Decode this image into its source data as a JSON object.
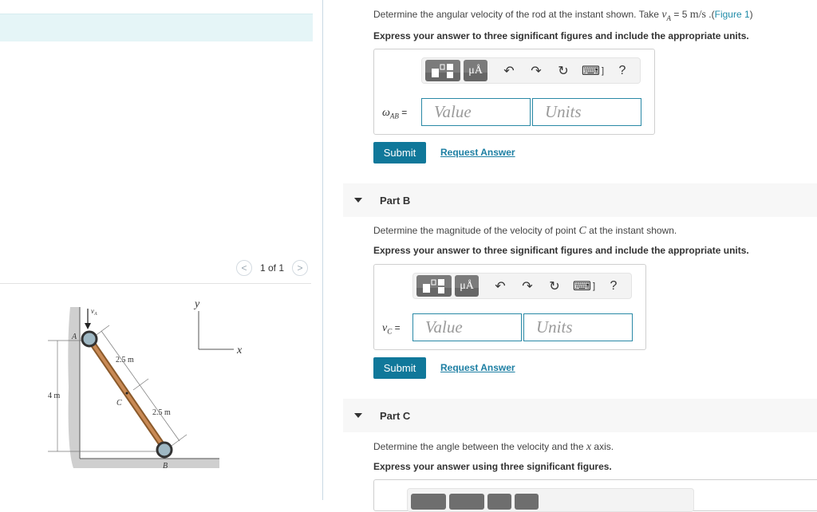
{
  "figure_panel": {
    "pager": {
      "prev_label": "<",
      "text": "1 of 1",
      "next_label": ">"
    },
    "figure": {
      "label_va": "v",
      "label_va_sub": "A",
      "label_A": "A",
      "label_B": "B",
      "label_C": "C",
      "label_upper_len": "2.5 m",
      "label_lower_len": "2.5 m",
      "label_height": "4 m",
      "axis_x": "x",
      "axis_y": "y"
    }
  },
  "part_a": {
    "prompt_pre": "Determine the angular velocity of the rod at the instant shown. Take ",
    "prompt_var": "v",
    "prompt_var_sub": "A",
    "prompt_eq": " = 5 ",
    "prompt_unit": "m/s",
    "prompt_post": " .(",
    "figure_link": "Figure 1",
    "prompt_close": ")",
    "instruction": "Express your answer to three significant figures and include the appropriate units.",
    "label_symbol": "ω",
    "label_sub": "AB",
    "label_eq": " =",
    "value_placeholder": "Value",
    "units_placeholder": "Units",
    "submit_label": "Submit",
    "request_label": "Request Answer"
  },
  "part_b": {
    "title": "Part B",
    "prompt_pre": "Determine the magnitude of the velocity of point ",
    "prompt_var": "C",
    "prompt_post": " at the instant shown.",
    "instruction": "Express your answer to three significant figures and include the appropriate units.",
    "label_symbol": "v",
    "label_sub": "C",
    "label_eq": " =",
    "value_placeholder": "Value",
    "units_placeholder": "Units",
    "submit_label": "Submit",
    "request_label": "Request Answer"
  },
  "part_c": {
    "title": "Part C",
    "prompt_pre": "Determine the angle between the velocity and the ",
    "prompt_var": "x",
    "prompt_post": " axis.",
    "instruction": "Express your answer using three significant figures."
  },
  "toolbar": {
    "templates_icon": "templates-icon",
    "units_label": "μÅ",
    "undo_glyph": "↶",
    "redo_glyph": "↷",
    "reset_glyph": "↻",
    "keyboard_glyph": "⌨",
    "keyboard_bracket": "]",
    "help_label": "?"
  },
  "colors": {
    "accent": "#10789a",
    "link": "#1d7fa3",
    "input_border": "#2a89a6",
    "banner": "#e5f5f7"
  }
}
